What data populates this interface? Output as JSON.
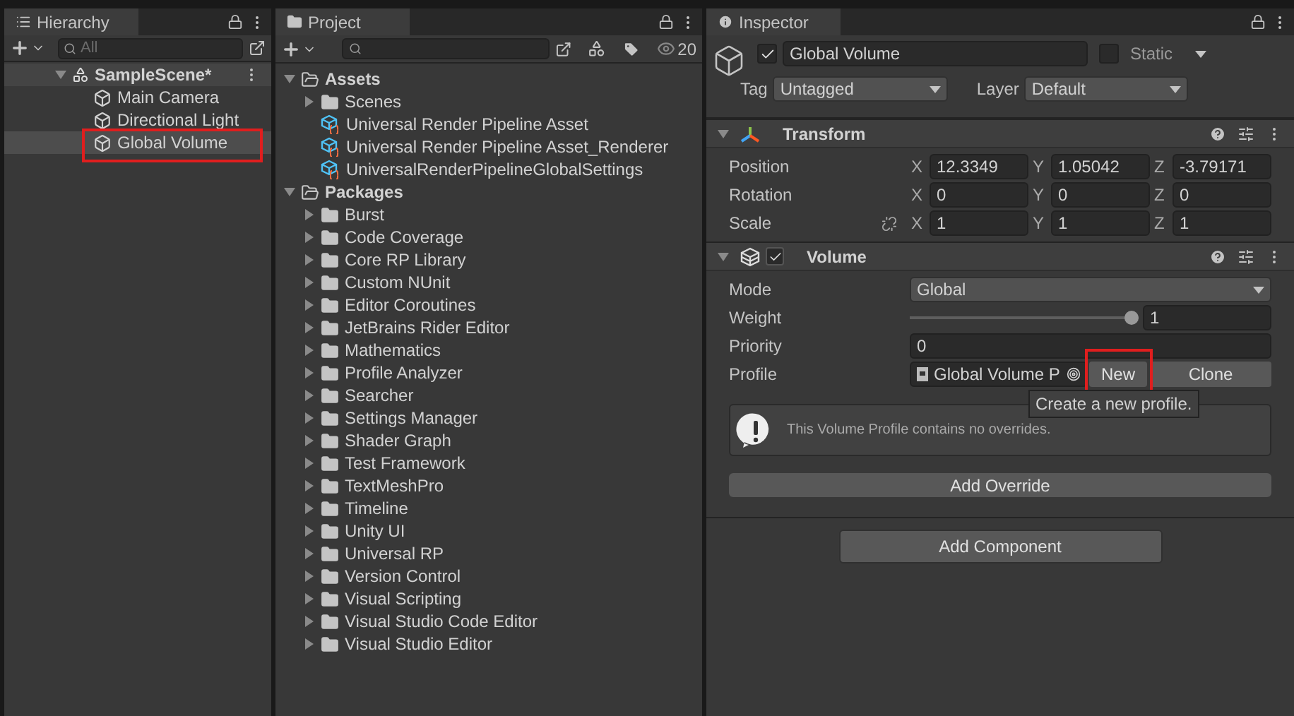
{
  "hierarchy": {
    "title": "Hierarchy",
    "search_placeholder": "All",
    "scene": {
      "name": "SampleScene*",
      "expanded": true
    },
    "items": [
      {
        "name": "Main Camera",
        "selected": false,
        "highlighted": false
      },
      {
        "name": "Directional Light",
        "selected": false,
        "highlighted": false
      },
      {
        "name": "Global Volume",
        "selected": true,
        "highlighted": true
      }
    ]
  },
  "project": {
    "title": "Project",
    "count": "20",
    "tree": [
      {
        "name": "Assets",
        "kind": "root",
        "expanded": true,
        "children": [
          {
            "name": "Scenes",
            "kind": "folder",
            "expanded": false
          },
          {
            "name": "Universal Render Pipeline Asset",
            "kind": "asset"
          },
          {
            "name": "Universal Render Pipeline Asset_Renderer",
            "kind": "asset"
          },
          {
            "name": "UniversalRenderPipelineGlobalSettings",
            "kind": "asset"
          }
        ]
      },
      {
        "name": "Packages",
        "kind": "root",
        "expanded": true,
        "children": [
          {
            "name": "Burst",
            "kind": "folder",
            "expanded": false
          },
          {
            "name": "Code Coverage",
            "kind": "folder",
            "expanded": false
          },
          {
            "name": "Core RP Library",
            "kind": "folder",
            "expanded": false
          },
          {
            "name": "Custom NUnit",
            "kind": "folder",
            "expanded": false
          },
          {
            "name": "Editor Coroutines",
            "kind": "folder",
            "expanded": false
          },
          {
            "name": "JetBrains Rider Editor",
            "kind": "folder",
            "expanded": false
          },
          {
            "name": "Mathematics",
            "kind": "folder",
            "expanded": false
          },
          {
            "name": "Profile Analyzer",
            "kind": "folder",
            "expanded": false
          },
          {
            "name": "Searcher",
            "kind": "folder",
            "expanded": false
          },
          {
            "name": "Settings Manager",
            "kind": "folder",
            "expanded": false
          },
          {
            "name": "Shader Graph",
            "kind": "folder",
            "expanded": false
          },
          {
            "name": "Test Framework",
            "kind": "folder",
            "expanded": false
          },
          {
            "name": "TextMeshPro",
            "kind": "folder",
            "expanded": false
          },
          {
            "name": "Timeline",
            "kind": "folder",
            "expanded": false
          },
          {
            "name": "Unity UI",
            "kind": "folder",
            "expanded": false
          },
          {
            "name": "Universal RP",
            "kind": "folder",
            "expanded": false
          },
          {
            "name": "Version Control",
            "kind": "folder",
            "expanded": false
          },
          {
            "name": "Visual Scripting",
            "kind": "folder",
            "expanded": false
          },
          {
            "name": "Visual Studio Code Editor",
            "kind": "folder",
            "expanded": false
          },
          {
            "name": "Visual Studio Editor",
            "kind": "folder",
            "expanded": false
          }
        ]
      }
    ]
  },
  "inspector": {
    "title": "Inspector",
    "object": {
      "active": true,
      "name": "Global Volume",
      "static": false,
      "static_label": "Static",
      "tag_label": "Tag",
      "tag": "Untagged",
      "layer_label": "Layer",
      "layer": "Default"
    },
    "transform": {
      "title": "Transform",
      "expanded": true,
      "rows": [
        {
          "label": "Position",
          "fields": [
            {
              "axis": "X",
              "value": "12.3349"
            },
            {
              "axis": "Y",
              "value": "1.05042"
            },
            {
              "axis": "Z",
              "value": "-3.79171"
            }
          ]
        },
        {
          "label": "Rotation",
          "fields": [
            {
              "axis": "X",
              "value": "0"
            },
            {
              "axis": "Y",
              "value": "0"
            },
            {
              "axis": "Z",
              "value": "0"
            }
          ]
        },
        {
          "label": "Scale",
          "linked": true,
          "fields": [
            {
              "axis": "X",
              "value": "1"
            },
            {
              "axis": "Y",
              "value": "1"
            },
            {
              "axis": "Z",
              "value": "1"
            }
          ]
        }
      ]
    },
    "volume": {
      "title": "Volume",
      "expanded": true,
      "enabled": true,
      "mode_label": "Mode",
      "mode": "Global",
      "weight_label": "Weight",
      "weight": {
        "level": 1,
        "reading": "1"
      },
      "priority_label": "Priority",
      "priority": "0",
      "profile_label": "Profile",
      "profile": "Global Volume P",
      "new_button": {
        "label": "New",
        "highlighted": true
      },
      "clone_button": "Clone",
      "tooltip": "Create a new profile.",
      "message": "This Volume Profile contains no overrides.",
      "add_override": "Add Override"
    },
    "add_component": "Add Component"
  }
}
